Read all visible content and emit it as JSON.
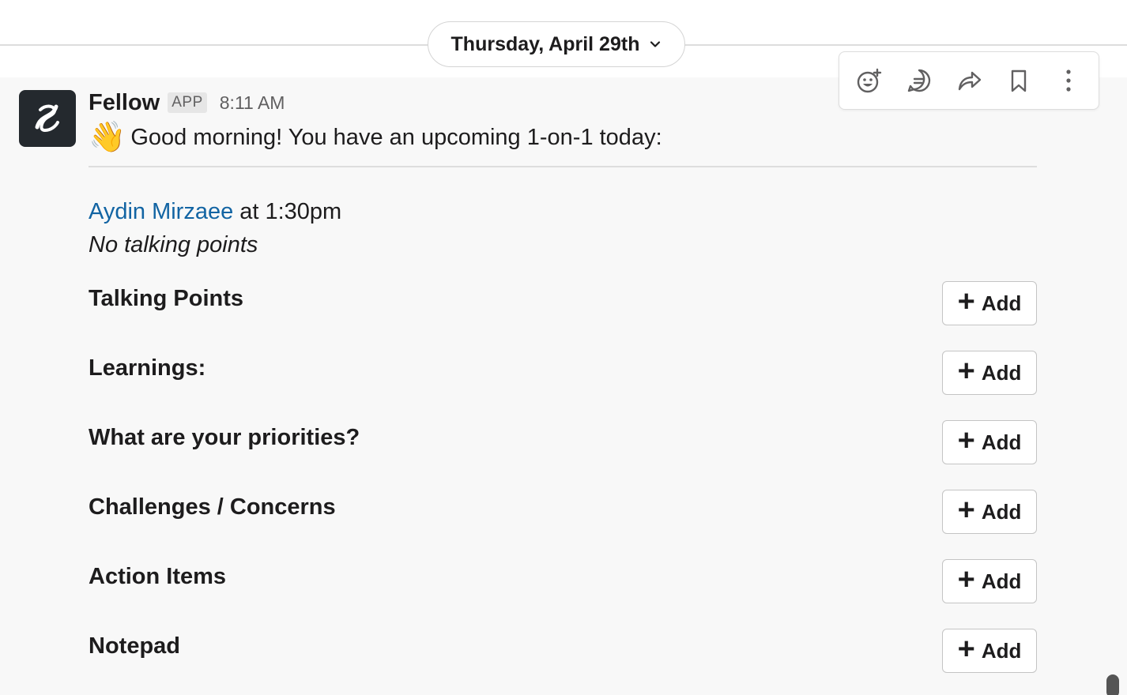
{
  "date_divider": {
    "label": "Thursday, April 29th"
  },
  "toolbar": [
    {
      "icon": "add-reaction-icon"
    },
    {
      "icon": "reply-in-thread-icon"
    },
    {
      "icon": "share-icon"
    },
    {
      "icon": "bookmark-icon"
    },
    {
      "icon": "more-actions-icon"
    }
  ],
  "message": {
    "sender": "Fellow",
    "badge": "APP",
    "time": "8:11 AM",
    "emoji": "👋",
    "greeting": "Good morning! You have an upcoming 1-on-1 today:",
    "person": "Aydin Mirzaee",
    "meeting_time": "at 1:30pm",
    "no_points": "No talking points"
  },
  "sections": [
    {
      "label": "Talking Points",
      "button": "Add"
    },
    {
      "label": "Learnings:",
      "button": "Add"
    },
    {
      "label": "What are your priorities?",
      "button": "Add"
    },
    {
      "label": "Challenges / Concerns",
      "button": "Add"
    },
    {
      "label": "Action Items",
      "button": "Add"
    },
    {
      "label": "Notepad",
      "button": "Add"
    }
  ]
}
